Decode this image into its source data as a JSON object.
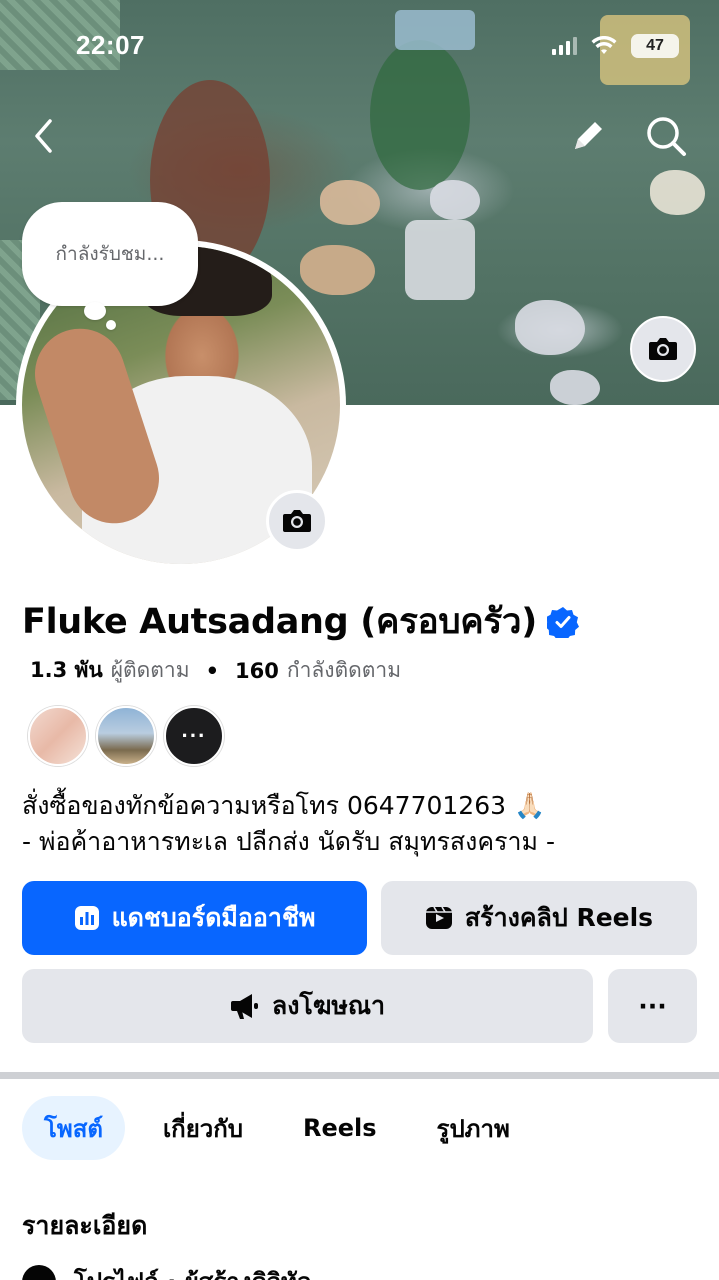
{
  "status_bar": {
    "time": "22:07",
    "battery": "47"
  },
  "cover": {
    "camera_icon": "camera-icon"
  },
  "avatar": {
    "bubble_text": "กำลังรับชม..."
  },
  "profile": {
    "name": "Fluke Autsadang (ครอบครัว)",
    "followers_count": "1.3 พัน",
    "followers_label": "ผู้ติดตาม",
    "separator": "•",
    "following_count": "160",
    "following_label": "กำลังติดตาม",
    "friends_more": "···",
    "bio_line1": "สั่งซื้อของทักข้อความหรือโทร 0647701263 🙏🏻",
    "bio_line2": "- พ่อค้าอาหารทะเล ปลีกส่ง นัดรับ สมุทรสงคราม -"
  },
  "actions": {
    "dashboard": "แดชบอร์ดมืออาชีพ",
    "create_reels": "สร้างคลิป Reels",
    "advertise": "ลงโฆษณา",
    "more": "···"
  },
  "tabs": [
    {
      "label": "โพสต์",
      "active": true
    },
    {
      "label": "เกี่ยวกับ",
      "active": false
    },
    {
      "label": "Reels",
      "active": false
    },
    {
      "label": "รูปภาพ",
      "active": false
    }
  ],
  "details": {
    "title": "รายละเอียด",
    "first_row": "โปรไฟล์ · ผู้สร้างดิจิทัล"
  },
  "colors": {
    "primary": "#0866ff",
    "secondary_bg": "#e4e6eb",
    "tab_active_bg": "#e7f3ff",
    "verified": "#0866ff"
  }
}
